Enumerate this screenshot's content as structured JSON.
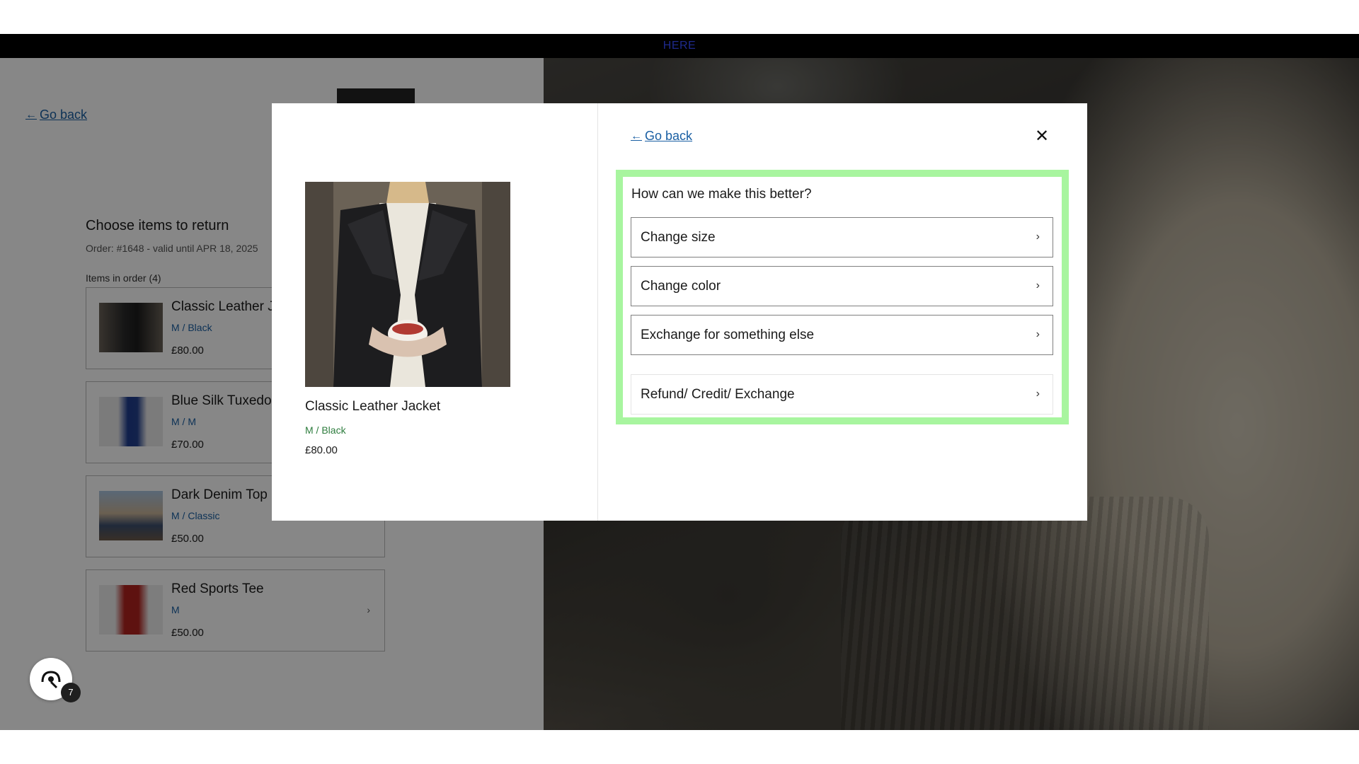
{
  "announcement": {
    "text": "HERE"
  },
  "background": {
    "go_back": "Go back",
    "choose_title": "Choose items to return",
    "order_line": "Order: #1648 - valid until APR 18, 2025",
    "items_label": "Items in order (4)",
    "items": [
      {
        "name": "Classic Leather J",
        "variant": "M / Black",
        "price": "£80.00"
      },
      {
        "name": "Blue Silk Tuxedo",
        "variant": "M / M",
        "price": "£70.00"
      },
      {
        "name": "Dark Denim Top",
        "variant": "M / Classic",
        "price": "£50.00"
      },
      {
        "name": "Red Sports Tee",
        "variant": "M",
        "price": "£50.00"
      }
    ]
  },
  "modal": {
    "go_back": "Go back",
    "close_icon": "close-icon",
    "product": {
      "name": "Classic Leather Jacket",
      "variant": "M / Black",
      "price": "£80.00"
    },
    "question": "How can we make this better?",
    "options": [
      {
        "label": "Change size"
      },
      {
        "label": "Change color"
      },
      {
        "label": "Exchange for something else"
      },
      {
        "label": "Refund/ Credit/ Exchange"
      }
    ]
  },
  "help_widget": {
    "badge_count": "7",
    "icon": "support-icon"
  },
  "colors": {
    "highlight": "#a8f59f",
    "link": "#1a5fa3",
    "variant_green": "#2e7d3e"
  }
}
